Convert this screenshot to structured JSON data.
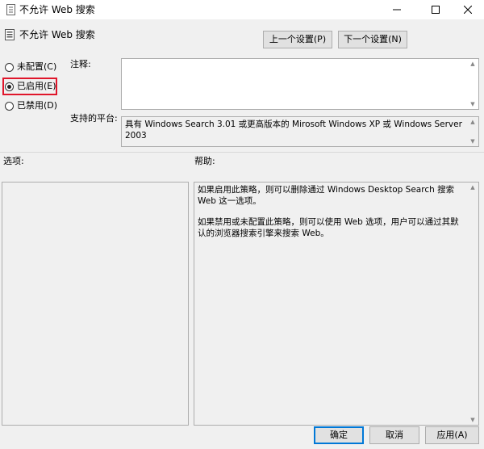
{
  "window": {
    "title": "不允许 Web 搜索",
    "icon": "policy-doc-icon",
    "controls": {
      "minimize": "minimize-icon",
      "maximize": "maximize-icon",
      "close": "close-icon"
    }
  },
  "header": {
    "policy_name": "不允许 Web 搜索",
    "prev_button": "上一个设置(P)",
    "next_button": "下一个设置(N)"
  },
  "state": {
    "options": [
      {
        "label": "未配置(C)",
        "checked": false
      },
      {
        "label": "已启用(E)",
        "checked": true
      },
      {
        "label": "已禁用(D)",
        "checked": false
      }
    ],
    "highlight_color": "#e0162b"
  },
  "comment": {
    "label": "注释:",
    "value": ""
  },
  "platform": {
    "label": "支持的平台:",
    "value": "具有 Windows Search 3.01 或更高版本的 Mirosoft Windows XP 或 Windows Server 2003"
  },
  "options_panel": {
    "label": "选项:"
  },
  "help_panel": {
    "label": "帮助:",
    "paragraphs": [
      "如果启用此策略，则可以删除通过 Windows Desktop Search 搜索 Web 这一选项。",
      "如果禁用或未配置此策略，则可以使用 Web 选项，用户可以通过其默认的浏览器搜索引擎来搜索 Web。"
    ]
  },
  "footer": {
    "ok": "确定",
    "cancel": "取消",
    "apply": "应用(A)"
  }
}
